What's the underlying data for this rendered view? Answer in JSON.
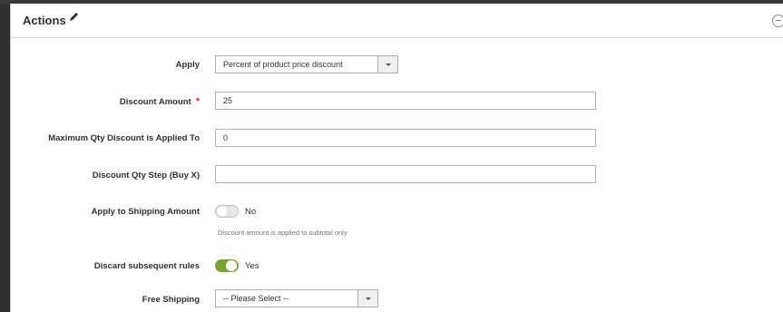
{
  "section": {
    "title": "Actions"
  },
  "fields": {
    "apply": {
      "label": "Apply",
      "value": "Percent of product price discount"
    },
    "discount_amount": {
      "label": "Discount Amount",
      "required_mark": "*",
      "value": "25"
    },
    "max_qty": {
      "label": "Maximum Qty Discount is Applied To",
      "value": "0"
    },
    "qty_step": {
      "label": "Discount Qty Step (Buy X)",
      "value": ""
    },
    "apply_shipping": {
      "label": "Apply to Shipping Amount",
      "state_text": "No",
      "note": "Discount amount is applied to subtotal only",
      "on": false
    },
    "discard_rules": {
      "label": "Discard subsequent rules",
      "state_text": "Yes",
      "on": true
    },
    "free_shipping": {
      "label": "Free Shipping",
      "value": "-- Please Select --"
    }
  },
  "icons": {
    "edit": "pencil-icon",
    "collapse": "collapse-icon",
    "dropdown": "chevron-down-icon"
  },
  "colors": {
    "toggle_on": "#79a22e",
    "required": "#e22626"
  }
}
